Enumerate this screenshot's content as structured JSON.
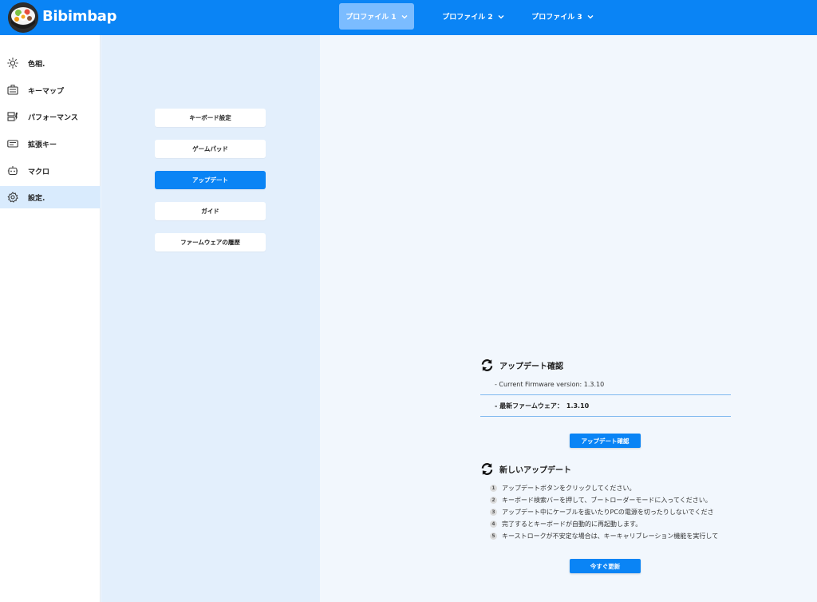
{
  "app": {
    "brand": "Bibimbap"
  },
  "profiles": [
    {
      "label": "プロファイル 1"
    },
    {
      "label": "プロファイル 2"
    },
    {
      "label": "プロファイル 3"
    }
  ],
  "sidebar": {
    "items": [
      {
        "label": "色相.",
        "icon": "sun-icon"
      },
      {
        "label": "キーマップ",
        "icon": "keyboard-icon"
      },
      {
        "label": "パフォーマンス",
        "icon": "performance-icon"
      },
      {
        "label": "拡張キー",
        "icon": "extended-key-icon"
      },
      {
        "label": "マクロ",
        "icon": "robot-icon"
      },
      {
        "label": "設定.",
        "icon": "gear-icon"
      }
    ],
    "active_index": 5
  },
  "settings_menu": {
    "items": [
      {
        "label": "キーボード設定"
      },
      {
        "label": "ゲームパッド"
      },
      {
        "label": "アップデート"
      },
      {
        "label": "ガイド"
      },
      {
        "label": "ファームウェアの履歴"
      }
    ],
    "active_index": 2
  },
  "update_check": {
    "title": "アップデート確認",
    "current_fw_label": "- Current Firmware version: 1.3.10",
    "latest_fw_label": "- 最新ファームウェア：",
    "latest_fw_value": "1.3.10",
    "button": "アップデート確認"
  },
  "new_update": {
    "title": "新しいアップデート",
    "steps": [
      {
        "num": "1",
        "text": "アップデートボタンをクリックしてください。"
      },
      {
        "num": "2",
        "text": "キーボード検索バーを押して、ブートローダーモードに入ってください。"
      },
      {
        "num": "3",
        "text": "アップデート中にケーブルを抜いたりPCの電源を切ったりしないでくださ"
      },
      {
        "num": "4",
        "text": "完了するとキーボードが自動的に再起動します。"
      },
      {
        "num": "5",
        "text": "キーストロークが不安定な場合は、キーキャリブレーション機能を実行して"
      }
    ],
    "button": "今すぐ更新"
  },
  "colors": {
    "accent": "#0a84f5",
    "sidebar_active": "#d9ebfd",
    "settings_bg": "#e3effc",
    "main_bg": "#f2f7fd"
  }
}
